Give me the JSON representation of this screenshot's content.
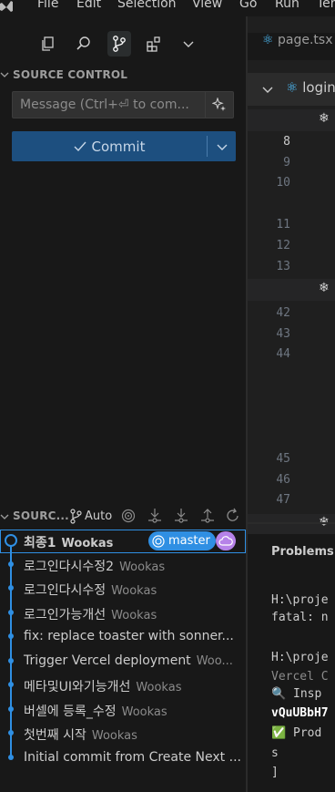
{
  "menu": [
    "File",
    "Edit",
    "Selection",
    "View",
    "Go",
    "Run",
    "Ter"
  ],
  "sidebar": {
    "tabs": [
      "explorer-icon",
      "search-icon",
      "source-control-icon",
      "extensions-icon",
      "chevron-down-icon"
    ],
    "section_title": "SOURCE CONTROL",
    "message_placeholder": "Message (Ctrl+⏎ to com...",
    "commit_label": "Commit",
    "graph": {
      "header": "SOURC...",
      "auto_label": "Auto",
      "commits": [
        {
          "message": "최종1",
          "author": "Wookas",
          "head": true
        },
        {
          "message": "로그인다시수정2",
          "author": "Wookas"
        },
        {
          "message": "로그인다시수정",
          "author": "Wookas"
        },
        {
          "message": "로그인가능개선",
          "author": "Wookas"
        },
        {
          "message": "fix: replace toaster with sonner...",
          "author": ""
        },
        {
          "message": "Trigger Vercel deployment",
          "author": "Woo..."
        },
        {
          "message": "메타및UI와기능개선",
          "author": "Wookas"
        },
        {
          "message": "버셀에 등록_수정",
          "author": "Wookas"
        },
        {
          "message": "첫번째 시작",
          "author": "Wookas"
        },
        {
          "message": "Initial commit from Create Next ...",
          "author": ""
        }
      ],
      "branch_badge": "master"
    }
  },
  "editor": {
    "tab": "page.tsx",
    "breadcrumb": "login",
    "line_numbers": [
      "8",
      "9",
      "10",
      "11",
      "12",
      "13",
      "42",
      "43",
      "44",
      "45",
      "46",
      "47"
    ]
  },
  "panel": {
    "tab": "Problems",
    "terminal": [
      "H:\\proje",
      "fatal: n",
      "H:\\proje",
      "Vercel C",
      "🔍  Insp",
      "vQuUBbH7",
      "✅  Prod",
      "s",
      "]"
    ]
  },
  "colors": {
    "accent": "#2f8fe3",
    "commit_button": "#1d4f7f",
    "cloud_badge": "#b682e8"
  }
}
